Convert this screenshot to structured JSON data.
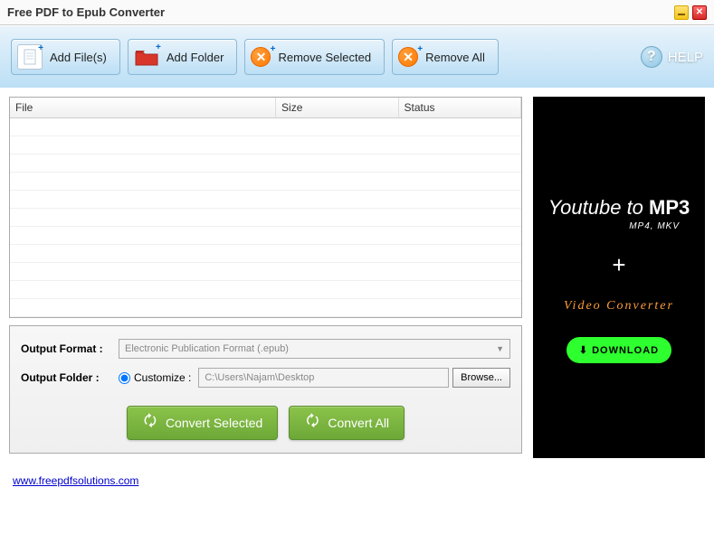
{
  "window": {
    "title": "Free PDF to Epub Converter"
  },
  "toolbar": {
    "add_files": "Add File(s)",
    "add_folder": "Add Folder",
    "remove_selected": "Remove Selected",
    "remove_all": "Remove All",
    "help": "HELP"
  },
  "table": {
    "headers": {
      "file": "File",
      "size": "Size",
      "status": "Status"
    }
  },
  "output": {
    "format_label": "Output Format :",
    "format_value": "Electronic Publication Format (.epub)",
    "folder_label": "Output Folder :",
    "customize_label": "Customize :",
    "folder_path": "C:\\Users\\Najam\\Desktop",
    "browse": "Browse..."
  },
  "actions": {
    "convert_selected": "Convert Selected",
    "convert_all": "Convert All"
  },
  "ad": {
    "line1_a": "Youtube to ",
    "line1_b": "MP3",
    "line2": "MP4, MKV",
    "plus": "+",
    "line3": "Video Converter",
    "download": "DOWNLOAD"
  },
  "footer": {
    "link": "www.freepdfsolutions.com"
  }
}
